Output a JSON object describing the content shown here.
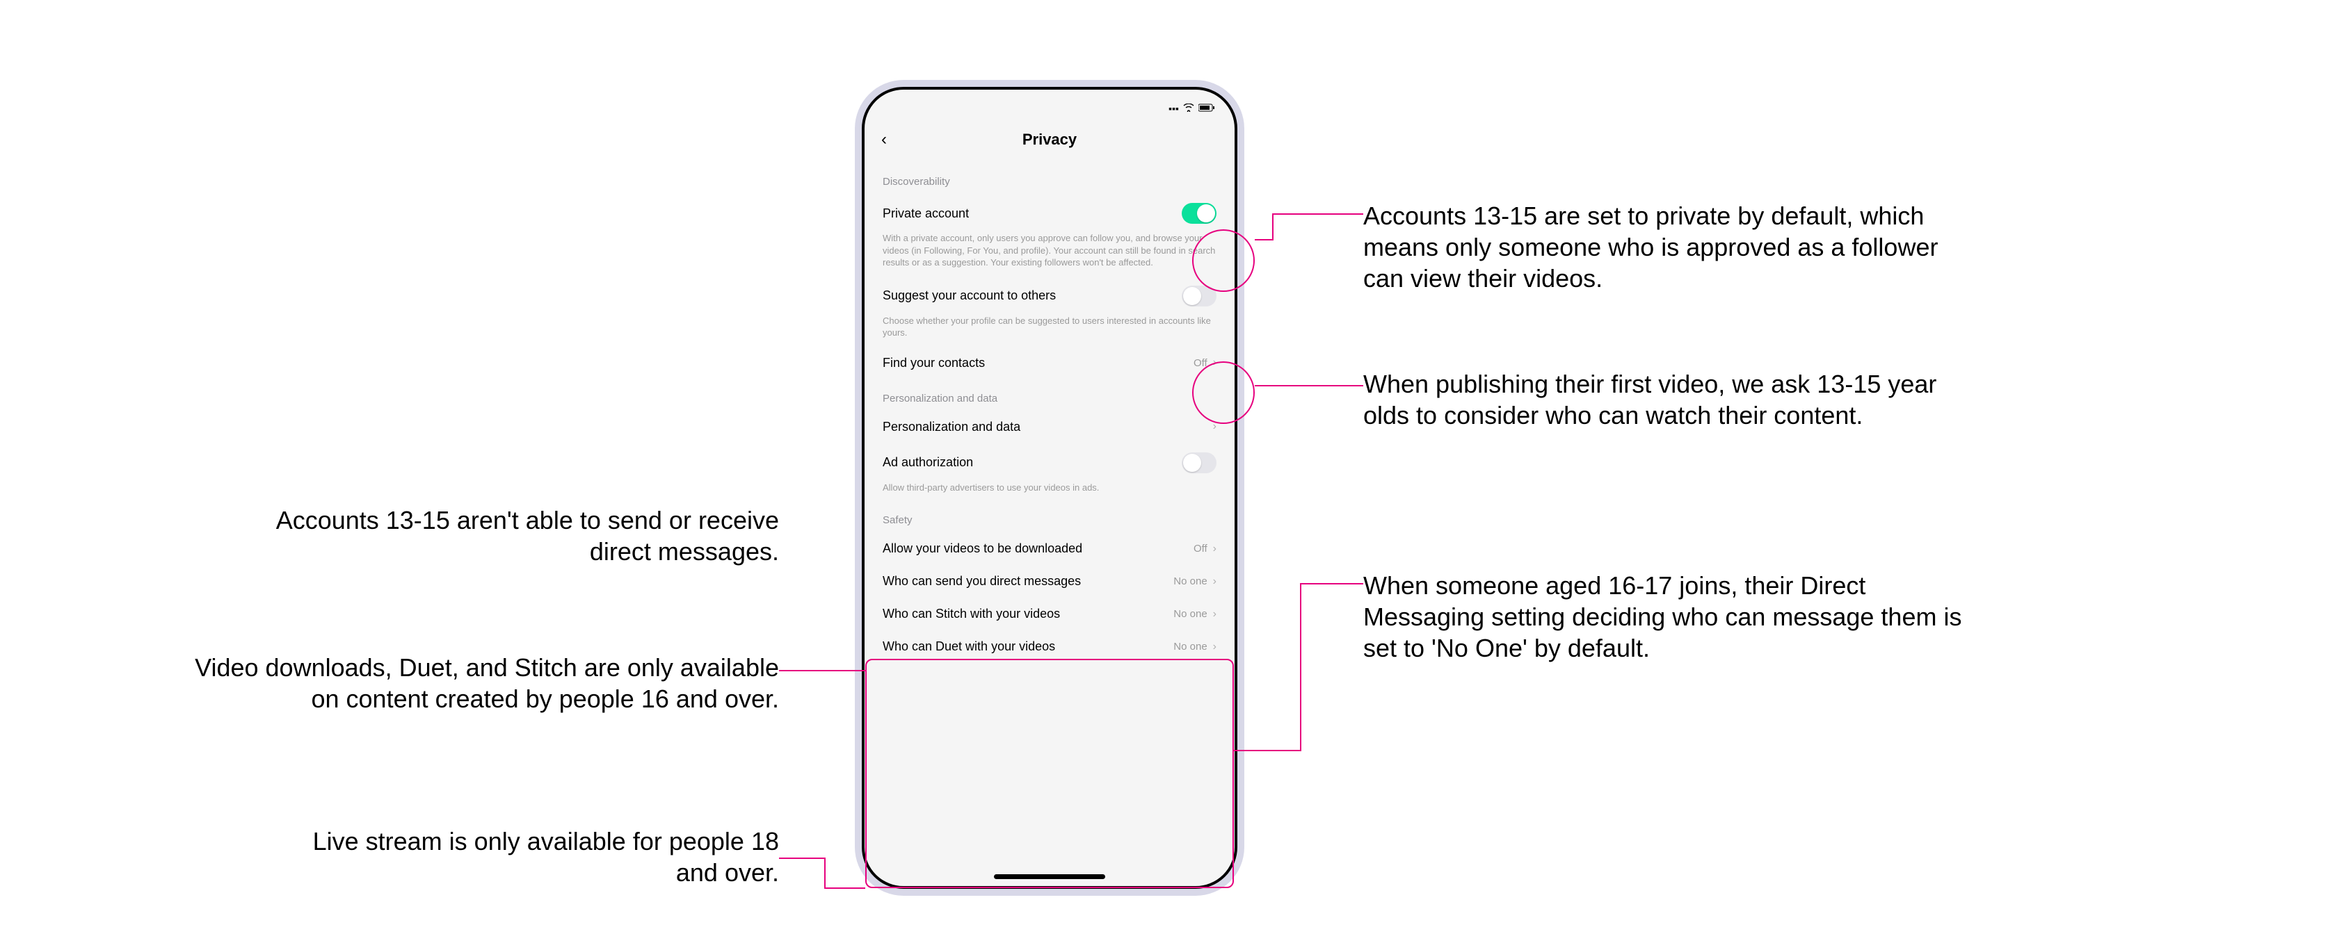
{
  "phone": {
    "header_title": "Privacy",
    "sections": {
      "discoverability_label": "Discoverability",
      "private_account": {
        "label": "Private account",
        "desc": "With a private account, only users you approve can follow you, and browse your videos (in Following, For You, and profile). Your account can still be found in search results or as a suggestion. Your existing followers won't be affected.",
        "toggle": "on"
      },
      "suggest_account": {
        "label": "Suggest your account to others",
        "desc": "Choose whether your profile can be suggested to users interested in accounts like yours.",
        "toggle": "off"
      },
      "find_contacts": {
        "label": "Find your contacts",
        "value": "Off"
      },
      "personalization_label": "Personalization and data",
      "personalization_row": {
        "label": "Personalization and data"
      },
      "ad_auth": {
        "label": "Ad authorization",
        "desc": "Allow third-party advertisers to use your videos in ads.",
        "toggle": "off"
      },
      "safety_label": "Safety",
      "downloads": {
        "label": "Allow your videos to be downloaded",
        "value": "Off"
      },
      "dm": {
        "label": "Who can send you direct messages",
        "value": "No one"
      },
      "stitch": {
        "label": "Who can Stitch with your videos",
        "value": "No one"
      },
      "duet": {
        "label": "Who can Duet with your videos",
        "value": "No one"
      }
    }
  },
  "annotations": {
    "left1": "Accounts 13-15 aren't able to send or receive direct messages.",
    "left2": "Video downloads, Duet, and Stitch are only available on content created by people 16 and over.",
    "left3": "Live stream is only available for people 18 and over.",
    "right1": "Accounts 13-15 are set to private by default, which means only someone who is approved as a follower can view their videos.",
    "right2": "When publishing their first video, we ask 13-15 year olds to consider who can watch their content.",
    "right3": "When someone aged 16-17 joins, their Direct Messaging setting deciding who can message them is set to 'No One' by default."
  },
  "colors": {
    "accent_pink": "#e6007e",
    "toggle_on": "#0be09b"
  }
}
